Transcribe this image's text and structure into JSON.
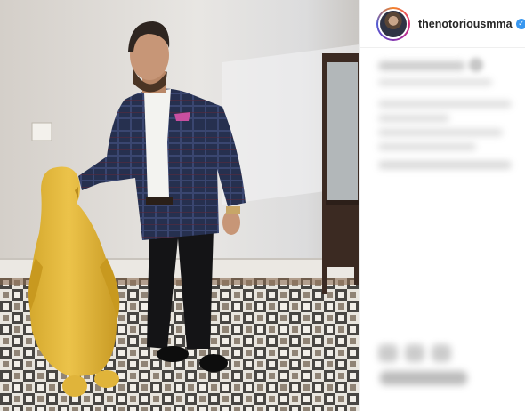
{
  "post": {
    "username": "thenotoriousmma",
    "verified_icon": "verified-badge-icon",
    "separator": "•"
  },
  "colors": {
    "verified": "#3897f0",
    "username_text": "#262626",
    "penguin": "#e2b93c"
  }
}
